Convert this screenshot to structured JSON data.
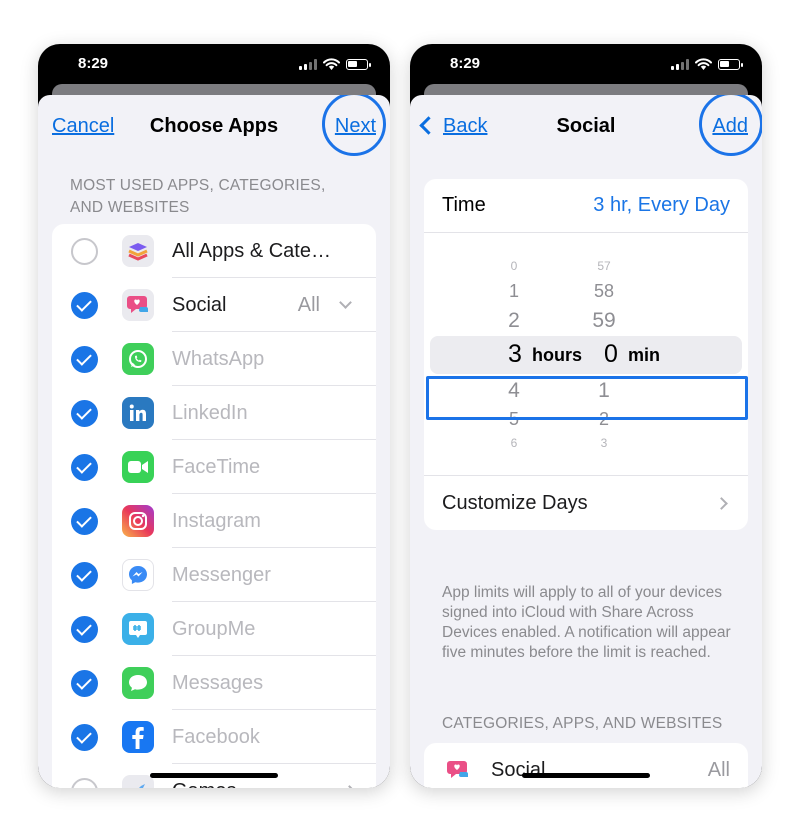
{
  "status": {
    "time": "8:29"
  },
  "left": {
    "nav": {
      "cancel": "Cancel",
      "title": "Choose Apps",
      "next": "Next"
    },
    "section_header": "MOST USED APPS, CATEGORIES, AND WEBSITES",
    "rows": [
      {
        "label": "All Apps & Categor...",
        "checked": false,
        "icon": "stack-icon",
        "dim": false
      },
      {
        "label": "Social",
        "checked": true,
        "icon": "social-chat-icon",
        "dim": false,
        "detail": "All"
      },
      {
        "label": "WhatsApp",
        "checked": true,
        "icon": "whatsapp-icon",
        "dim": true
      },
      {
        "label": "LinkedIn",
        "checked": true,
        "icon": "linkedin-icon",
        "dim": true
      },
      {
        "label": "FaceTime",
        "checked": true,
        "icon": "facetime-icon",
        "dim": true
      },
      {
        "label": "Instagram",
        "checked": true,
        "icon": "instagram-icon",
        "dim": true
      },
      {
        "label": "Messenger",
        "checked": true,
        "icon": "messenger-icon",
        "dim": true
      },
      {
        "label": "GroupMe",
        "checked": true,
        "icon": "groupme-icon",
        "dim": true
      },
      {
        "label": "Messages",
        "checked": true,
        "icon": "messages-icon",
        "dim": true
      },
      {
        "label": "Facebook",
        "checked": true,
        "icon": "facebook-icon",
        "dim": true
      },
      {
        "label": "Games",
        "checked": false,
        "icon": "games-icon",
        "dim": false
      }
    ]
  },
  "right": {
    "nav": {
      "back": "Back",
      "title": "Social",
      "add": "Add"
    },
    "time_row": {
      "label": "Time",
      "value": "3 hr, Every Day"
    },
    "picker": {
      "hours_above": [
        "0",
        "1",
        "2"
      ],
      "hours_selected": "3",
      "hours_unit": "hours",
      "hours_below": [
        "4",
        "5",
        "6"
      ],
      "minutes_above": [
        "57",
        "58",
        "59"
      ],
      "minutes_selected": "0",
      "minutes_unit": "min",
      "minutes_below": [
        "1",
        "2",
        "3"
      ]
    },
    "customize_days": "Customize Days",
    "footnote": "App limits will apply to all of your devices signed into iCloud with Share Across Devices enabled. A notification will appear five minutes before the limit is reached.",
    "section_header": "CATEGORIES, APPS, AND WEBSITES",
    "category": {
      "label": "Social",
      "detail": "All"
    }
  },
  "colors": {
    "accent": "#1a75e6",
    "highlight": "#1b73e8",
    "background": "#f2f2f7"
  }
}
